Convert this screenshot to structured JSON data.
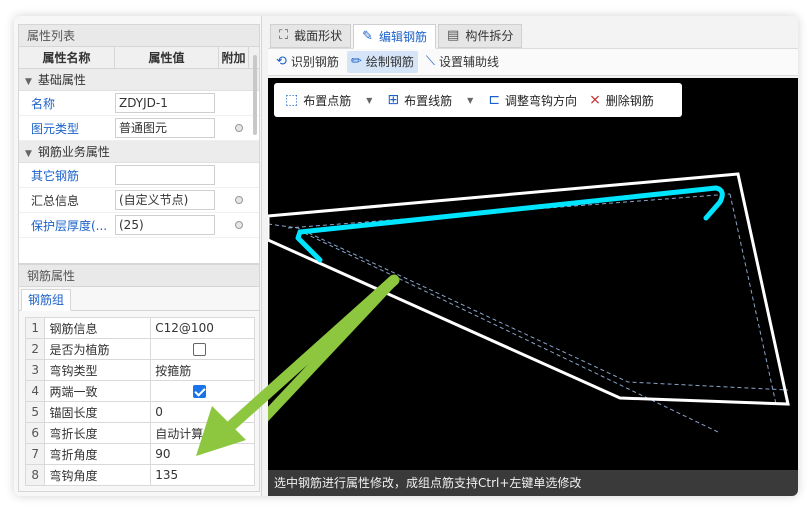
{
  "attr_panel": {
    "title": "属性列表",
    "headers": {
      "name": "属性名称",
      "value": "属性值",
      "add": "附加"
    },
    "groups": [
      {
        "label": "基础属性",
        "rows": [
          {
            "name": "名称",
            "value": "ZDYJD-1",
            "link": true
          },
          {
            "name": "图元类型",
            "value": "普通图元",
            "link": true
          }
        ]
      },
      {
        "label": "钢筋业务属性",
        "rows": [
          {
            "name": "其它钢筋",
            "value": "",
            "link": true
          },
          {
            "name": "汇总信息",
            "value": "(自定义节点)",
            "link": false
          },
          {
            "name": "保护层厚度(...",
            "value": "(25)",
            "link": true
          }
        ]
      }
    ]
  },
  "steel_panel": {
    "title": "钢筋属性",
    "tab": "钢筋组",
    "rows": [
      {
        "idx": "1",
        "name": "钢筋信息",
        "value": "C12@100"
      },
      {
        "idx": "2",
        "name": "是否为植筋",
        "value": ""
      },
      {
        "idx": "3",
        "name": "弯钩类型",
        "value": "按箍筋"
      },
      {
        "idx": "4",
        "name": "两端一致",
        "value": ""
      },
      {
        "idx": "5",
        "name": "锚固长度",
        "value": "0"
      },
      {
        "idx": "6",
        "name": "弯折长度",
        "value": "自动计算"
      },
      {
        "idx": "7",
        "name": "弯折角度",
        "value": "90"
      },
      {
        "idx": "8",
        "name": "弯钩角度",
        "value": "135"
      }
    ]
  },
  "main_tabs": [
    {
      "label": "截面形状",
      "icon": "section-shape-icon"
    },
    {
      "label": "编辑钢筋",
      "icon": "edit-rebar-icon"
    },
    {
      "label": "构件拆分",
      "icon": "split-component-icon"
    }
  ],
  "sub_toolbar": {
    "identify": "识别钢筋",
    "draw": "绘制钢筋",
    "aux_line": "设置辅助线"
  },
  "float_toolbar": {
    "point_rebar": "布置点筋",
    "line_rebar": "布置线筋",
    "hook_dir": "调整弯钩方向",
    "delete_rebar": "删除钢筋"
  },
  "status_text": "选中钢筋进行属性修改，成组点筋支持Ctrl+左键单选修改",
  "colors": {
    "accent": "#1b61c9",
    "rebar": "#00e5ff",
    "arrow": "#8dc63f"
  }
}
